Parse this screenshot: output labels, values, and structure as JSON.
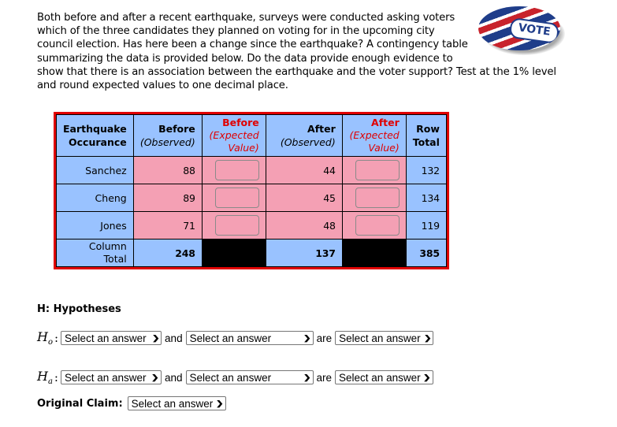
{
  "problem": {
    "text": "Both before and after a recent earthquake, surveys were conducted asking voters which of the three candidates they planned on voting for in the upcoming city council election. Has here been a change since the earthquake? A contingency table summarizing the data is provided below. Do the data provide enough evidence to show that there is an association between the earthquake and the voter support? Test at the 1% level and round expected values to one decimal place.",
    "image_label": "VOTE",
    "image_icon": "vote-buttons-image"
  },
  "table": {
    "headers": {
      "col0_line1": "Earthquake",
      "col0_line2": "Occurance",
      "before_obs_line1": "Before",
      "before_obs_line2": "(Observed)",
      "before_exp_line1": "Before",
      "before_exp_line2": "(Expected",
      "before_exp_line3": "Value)",
      "after_obs_line1": "After",
      "after_obs_line2": "(Observed)",
      "after_exp_line1": "After",
      "after_exp_line2": "(Expected",
      "after_exp_line3": "Value)",
      "row_total_line1": "Row",
      "row_total_line2": "Total"
    },
    "rows": [
      {
        "label": "Sanchez",
        "before": "88",
        "before_expected": "",
        "after": "44",
        "after_expected": "",
        "total": "132"
      },
      {
        "label": "Cheng",
        "before": "89",
        "before_expected": "",
        "after": "45",
        "after_expected": "",
        "total": "134"
      },
      {
        "label": "Jones",
        "before": "71",
        "before_expected": "",
        "after": "48",
        "after_expected": "",
        "total": "119"
      }
    ],
    "totals": {
      "label_line1": "Column",
      "label_line2": "Total",
      "before": "248",
      "after": "137",
      "grand": "385"
    },
    "colors": {
      "header_bg": "#99c2ff",
      "data_bg": "#f4a0b4",
      "border": "#e00000",
      "expected_text": "#e00000"
    }
  },
  "hypotheses": {
    "title": "H: Hypotheses",
    "null": {
      "symbol": "H",
      "subscript": "o",
      "colon": ":",
      "select1": "Select an answer",
      "conj1": "and",
      "select2": "Select an answer",
      "conj2": "are",
      "select3": "Select an answer"
    },
    "alt": {
      "symbol": "H",
      "subscript": "a",
      "colon": ":",
      "select1": "Select an answer",
      "conj1": "and",
      "select2": "Select an answer",
      "conj2": "are",
      "select3": "Select an answer"
    },
    "original_claim": {
      "label": "Original Claim:",
      "select": "Select an answer"
    }
  }
}
